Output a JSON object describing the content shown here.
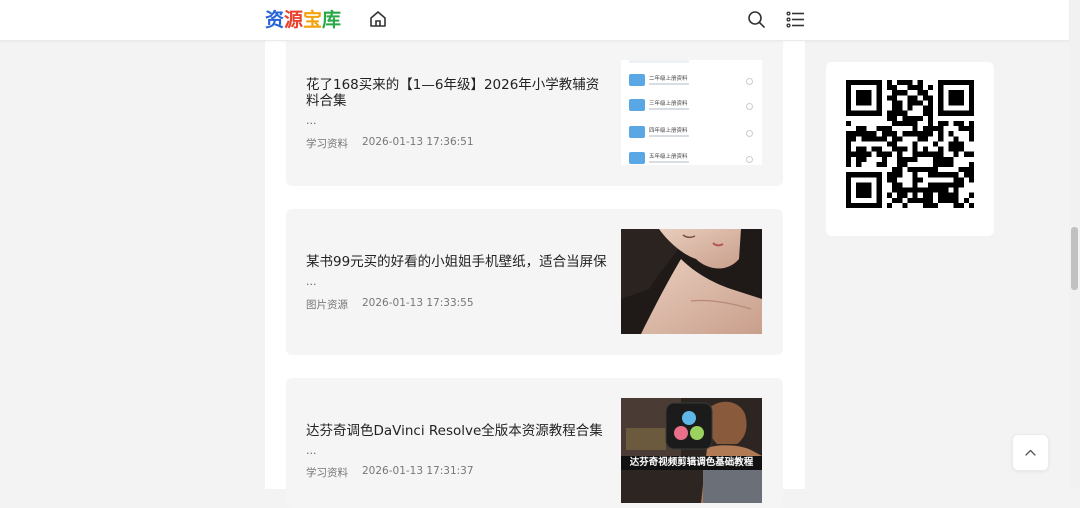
{
  "header": {
    "logo_chars": [
      "资",
      "源",
      "宝",
      "库"
    ],
    "logo_colors": [
      "#2563d6",
      "#e8412c",
      "#f2a20c",
      "#2aa845"
    ]
  },
  "posts": [
    {
      "title": "花了168买来的【1—6年级】2026年小学教辅资料合集",
      "excerpt": "...",
      "category": "学习资料",
      "date": "2026-01-13 17:36:51",
      "thumb": {
        "rows": [
          "二年级上册资料",
          "三年级上册资料",
          "四年级上册资料",
          "五年级上册资料"
        ]
      }
    },
    {
      "title": "某书99元买的好看的小姐姐手机壁纸，适合当屏保",
      "excerpt": "...",
      "category": "图片资源",
      "date": "2026-01-13 17:33:55"
    },
    {
      "title": "达芬奇调色DaVinci Resolve全版本资源教程合集",
      "excerpt": "...",
      "category": "学习资料",
      "date": "2026-01-13 17:31:37",
      "thumb": {
        "caption": "达芬奇视频剪辑调色基础教程"
      }
    }
  ],
  "icons": {
    "home": "home-icon",
    "search": "search-icon",
    "menu": "menu-list-icon",
    "back_to_top": "chevron-up-icon"
  }
}
